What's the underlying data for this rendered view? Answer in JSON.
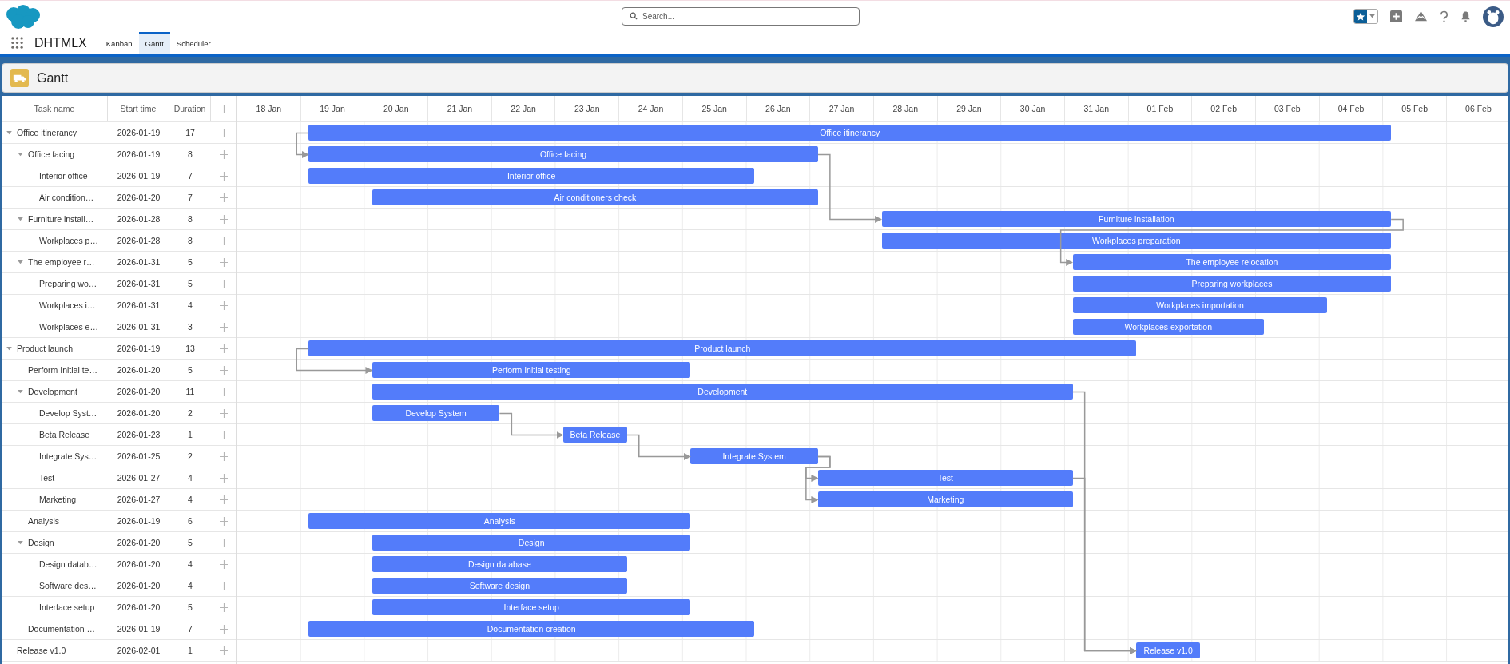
{
  "header": {
    "search": {
      "placeholder": "Search..."
    }
  },
  "nav": {
    "app_name": "DHTMLX",
    "tabs": [
      {
        "label": "Kanban",
        "selected": false
      },
      {
        "label": "Gantt",
        "selected": true
      },
      {
        "label": "Scheduler",
        "selected": false
      }
    ]
  },
  "page_header": {
    "title": "Gantt"
  },
  "gantt": {
    "columns": [
      "Task name",
      "Start time",
      "Duration"
    ],
    "scale": [
      "18 Jan",
      "19 Jan",
      "20 Jan",
      "21 Jan",
      "22 Jan",
      "23 Jan",
      "24 Jan",
      "25 Jan",
      "26 Jan",
      "27 Jan",
      "28 Jan",
      "29 Jan",
      "30 Jan",
      "31 Jan",
      "01 Feb",
      "02 Feb",
      "03 Feb",
      "04 Feb",
      "05 Feb",
      "06 Feb"
    ],
    "tasks": [
      {
        "name": "Office itinerancy",
        "start": "2026-01-19",
        "duration": "17",
        "bar_label": "Office itinerancy",
        "expanded": true,
        "children": [
          {
            "name": "Office facing",
            "start": "2026-01-19",
            "duration": "8",
            "bar_label": "Office facing",
            "expanded": true,
            "children": [
              {
                "name": "Interior office",
                "start": "2026-01-19",
                "duration": "7",
                "bar_label": "Interior office"
              },
              {
                "name": "Air condition…",
                "start": "2026-01-20",
                "duration": "7",
                "bar_label": "Air conditioners check"
              }
            ]
          },
          {
            "name": "Furniture install…",
            "start": "2026-01-28",
            "duration": "8",
            "bar_label": "Furniture installation",
            "expanded": true,
            "children": [
              {
                "name": "Workplaces p…",
                "start": "2026-01-28",
                "duration": "8",
                "bar_label": "Workplaces preparation"
              }
            ]
          },
          {
            "name": "The employee r…",
            "start": "2026-01-31",
            "duration": "5",
            "bar_label": "The employee relocation",
            "expanded": true,
            "children": [
              {
                "name": "Preparing wo…",
                "start": "2026-01-31",
                "duration": "5",
                "bar_label": "Preparing workplaces"
              },
              {
                "name": "Workplaces i…",
                "start": "2026-01-31",
                "duration": "4",
                "bar_label": "Workplaces importation"
              },
              {
                "name": "Workplaces e…",
                "start": "2026-01-31",
                "duration": "3",
                "bar_label": "Workplaces exportation"
              }
            ]
          }
        ]
      },
      {
        "name": "Product launch",
        "start": "2026-01-19",
        "duration": "13",
        "bar_label": "Product launch",
        "expanded": true,
        "children": [
          {
            "name": "Perform Initial te…",
            "start": "2026-01-20",
            "duration": "5",
            "bar_label": "Perform Initial testing"
          },
          {
            "name": "Development",
            "start": "2026-01-20",
            "duration": "11",
            "bar_label": "Development",
            "expanded": true,
            "children": [
              {
                "name": "Develop Syst…",
                "start": "2026-01-20",
                "duration": "2",
                "bar_label": "Develop System"
              },
              {
                "name": "Beta Release",
                "start": "2026-01-23",
                "duration": "1",
                "bar_label": "Beta Release"
              },
              {
                "name": "Integrate Sys…",
                "start": "2026-01-25",
                "duration": "2",
                "bar_label": "Integrate System"
              },
              {
                "name": "Test",
                "start": "2026-01-27",
                "duration": "4",
                "bar_label": "Test"
              },
              {
                "name": "Marketing",
                "start": "2026-01-27",
                "duration": "4",
                "bar_label": "Marketing"
              }
            ]
          },
          {
            "name": "Analysis",
            "start": "2026-01-19",
            "duration": "6",
            "bar_label": "Analysis"
          },
          {
            "name": "Design",
            "start": "2026-01-20",
            "duration": "5",
            "bar_label": "Design",
            "expanded": true,
            "children": [
              {
                "name": "Design datab…",
                "start": "2026-01-20",
                "duration": "4",
                "bar_label": "Design database"
              },
              {
                "name": "Software des…",
                "start": "2026-01-20",
                "duration": "4",
                "bar_label": "Software design"
              },
              {
                "name": "Interface setup",
                "start": "2026-01-20",
                "duration": "5",
                "bar_label": "Interface setup"
              }
            ]
          },
          {
            "name": "Documentation …",
            "start": "2026-01-19",
            "duration": "7",
            "bar_label": "Documentation creation"
          }
        ]
      },
      {
        "name": "Release v1.0",
        "start": "2026-02-01",
        "duration": "1",
        "bar_label": "Release v1.0"
      }
    ]
  }
}
